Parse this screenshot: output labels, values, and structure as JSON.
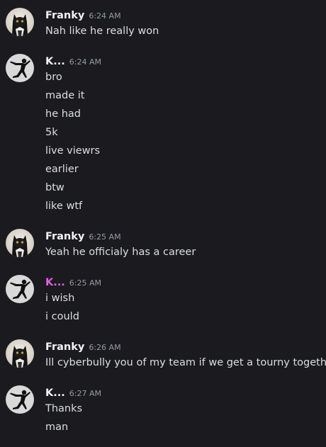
{
  "colors": {
    "background": "#1b1b1f",
    "text": "#dbdee1",
    "username": "#f2f3f5",
    "username_pink": "#e85ef0",
    "timestamp": "#949ba4"
  },
  "messages": [
    {
      "author": "Franky",
      "avatar_icon": "cat-avatar-icon",
      "time": "6:24 AM",
      "lines": [
        "Nah like he really won"
      ]
    },
    {
      "author": "K...",
      "avatar_icon": "dancer-silhouette-avatar-icon",
      "time": "6:24 AM",
      "lines": [
        "bro",
        "made it",
        "he had",
        "5k",
        "live viewrs",
        "earlier",
        "btw",
        "like wtf"
      ]
    },
    {
      "author": "Franky",
      "avatar_icon": "cat-avatar-icon",
      "time": "6:25 AM",
      "lines": [
        "Yeah he officialy has a career"
      ]
    },
    {
      "author": "K...",
      "avatar_icon": "dancer-silhouette-avatar-icon",
      "time": "6:25 AM",
      "lines": [
        "i wish",
        "i could"
      ]
    },
    {
      "author": "Franky",
      "avatar_icon": "cat-avatar-icon",
      "time": "6:26 AM",
      "lines": [
        "Ill cyberbully you of my team if we get a tourny together"
      ]
    },
    {
      "author": "K...",
      "avatar_icon": "dancer-silhouette-avatar-icon",
      "time": "6:27 AM",
      "lines": [
        "Thanks",
        "man"
      ]
    }
  ]
}
